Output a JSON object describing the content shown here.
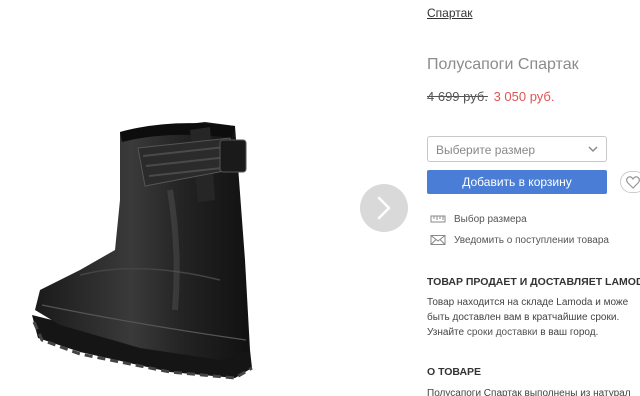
{
  "brand": {
    "label": "Спартак"
  },
  "product": {
    "title": "Полусапоги Спартак"
  },
  "price": {
    "old": "4 699 руб.",
    "new": "3 050 руб."
  },
  "size_select": {
    "placeholder": "Выберите размер"
  },
  "actions": {
    "add_to_cart": "Добавить в корзину"
  },
  "links": {
    "size_guide": "Выбор размера",
    "notify": "Уведомить о поступлении товара"
  },
  "seller": {
    "heading": "ТОВАР ПРОДАЕТ И ДОСТАВЛЯЕТ LAMODA",
    "line1": "Товар находится на складе Lamoda и може",
    "line2": "быть доставлен вам в кратчайшие сроки.",
    "line3_before": "Узнайте ",
    "line3_link": "сроки доставки",
    "line3_after": " в ваш город."
  },
  "about": {
    "heading": "О ТОВАРЕ",
    "text": "Полусапоги Спартак выполнены из натурал"
  },
  "colors": {
    "accent": "#4a7ed6",
    "sale": "#e05555",
    "muted": "#8c8c8c"
  },
  "icons": {
    "next": "chevron-right-icon",
    "dropdown": "chevron-down-icon",
    "wishlist": "heart-icon",
    "ruler": "ruler-icon",
    "mail": "envelope-icon"
  }
}
